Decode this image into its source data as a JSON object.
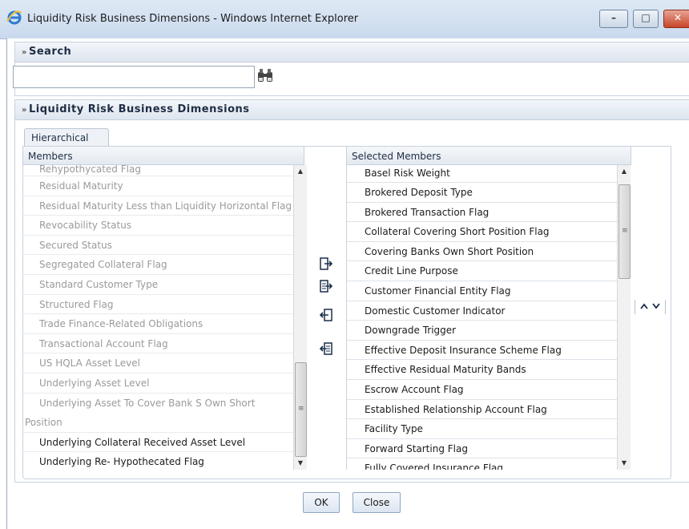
{
  "window": {
    "title": "Liquidity Risk Business Dimensions - Windows Internet Explorer",
    "controls": {
      "minimize": "–",
      "maximize": "□",
      "close": "✕"
    }
  },
  "search": {
    "header": "Search",
    "collapse_glyph": "»",
    "input_value": "",
    "icon": "binoculars-icon"
  },
  "dimensions": {
    "header": "Liquidity Risk Business Dimensions",
    "collapse_glyph": "»",
    "tab": "Hierarchical",
    "members_header": "Members",
    "selected_header": "Selected Members",
    "members": [
      {
        "label": "Rehypothycated Flag",
        "enabled": false
      },
      {
        "label": "Residual Maturity",
        "enabled": false
      },
      {
        "label": "Residual Maturity Less than Liquidity Horizontal Flag",
        "enabled": false
      },
      {
        "label": "Revocability Status",
        "enabled": false
      },
      {
        "label": "Secured Status",
        "enabled": false
      },
      {
        "label": "Segregated Collateral Flag",
        "enabled": false
      },
      {
        "label": "Standard Customer Type",
        "enabled": false
      },
      {
        "label": "Structured Flag",
        "enabled": false
      },
      {
        "label": "Trade Finance-Related Obligations",
        "enabled": false
      },
      {
        "label": "Transactional Account Flag",
        "enabled": false
      },
      {
        "label": "US HQLA Asset Level",
        "enabled": false
      },
      {
        "label": "Underlying Asset Level",
        "enabled": false
      },
      {
        "label": "Underlying Asset To Cover Bank S Own Short",
        "label2": "Position",
        "enabled": false
      },
      {
        "label": "Underlying Collateral Received Asset Level",
        "enabled": true
      },
      {
        "label": "Underlying Re- Hypothecated Flag",
        "enabled": true
      }
    ],
    "selected": [
      "Basel Risk Weight",
      "Brokered Deposit Type",
      "Brokered Transaction Flag",
      "Collateral Covering Short Position Flag",
      "Covering Banks Own Short Position",
      "Credit Line Purpose",
      "Customer Financial Entity Flag",
      "Domestic Customer Indicator",
      "Downgrade Trigger",
      "Effective Deposit Insurance Scheme Flag",
      "Effective Residual Maturity Bands",
      "Escrow Account Flag",
      "Established Relationship Account Flag",
      "Facility Type",
      "Forward Starting Flag",
      "Fully Covered Insurance Flag"
    ],
    "move_buttons": [
      "move-right-icon",
      "move-all-right-icon",
      "move-left-icon",
      "move-all-left-icon"
    ],
    "reorder": {
      "up": "^",
      "down": "v"
    }
  },
  "footer": {
    "ok": "OK",
    "close": "Close"
  },
  "colors": {
    "disabled_text": "#9a9a9a",
    "header_bg": "#dde5ef",
    "button_border": "#8ea6c3"
  }
}
